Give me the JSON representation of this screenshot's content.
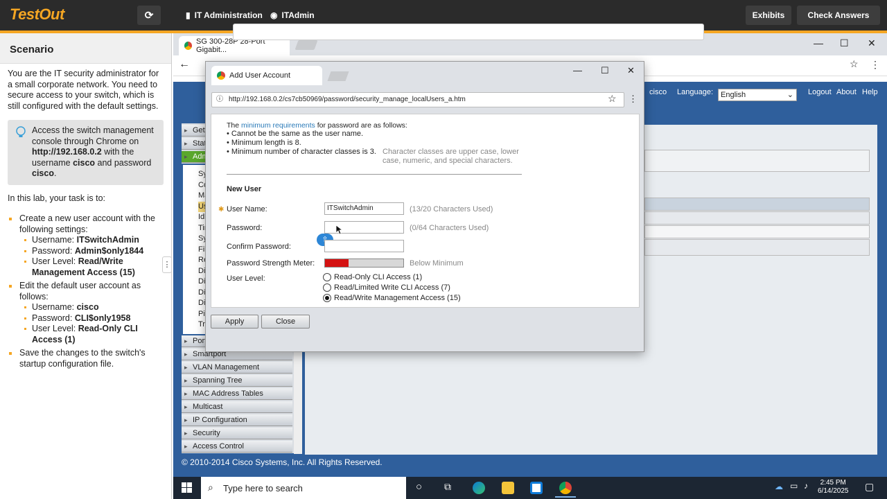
{
  "topbar": {
    "brand": "TestOut",
    "tab_admin": "IT Administration",
    "tab_itadmin": "ITAdmin",
    "exhibits": "Exhibits",
    "check_answers": "Check Answers"
  },
  "scenario": {
    "heading": "Scenario",
    "intro": "You are the IT security administrator for a small corporate network. You need to secure access to your switch, which is still configured with the default settings.",
    "callout_pre": "Access the switch management console through Chrome on ",
    "callout_url": "http://192.168.0.2",
    "callout_mid": " with the username ",
    "callout_user": "cisco",
    "callout_and": " and password ",
    "callout_pass": "cisco",
    "callout_end": ".",
    "task_intro": "In this lab, your task is to:",
    "task1": "Create a new user account with the following settings:",
    "t1_user_lbl": "Username: ",
    "t1_user": "ITSwitchAdmin",
    "t1_pass_lbl": "Password: ",
    "t1_pass": "Admin$only1844",
    "t1_level_lbl": "User Level: ",
    "t1_level": "Read/Write Management Access (15)",
    "task2": "Edit the default user account as follows:",
    "t2_user_lbl": "Username: ",
    "t2_user": "cisco",
    "t2_pass_lbl": "Password: ",
    "t2_pass": "CLI$only1958",
    "t2_level_lbl": "User Level: ",
    "t2_level": "Read-Only CLI Access (1)",
    "task3": "Save the changes to the switch's startup configuration file."
  },
  "browser": {
    "tab_title": "SG 300-28P 28-Port Gigabit...",
    "user": "cisco",
    "language_label": "Language:",
    "language_value": "English",
    "logout": "Logout",
    "about": "About",
    "help": "Help",
    "footer": "© 2010-2014 Cisco Systems, Inc. All Rights Reserved."
  },
  "nav": {
    "partial": [
      "Gett",
      "Statu",
      "Adm",
      "Sy",
      "Co",
      "Ma",
      "Us",
      "Idl",
      "Tin",
      "Sy",
      "File",
      "Re",
      "Dia",
      "Dis",
      "Dis",
      "Dis",
      "Pin",
      "Tra",
      "Port"
    ],
    "items": [
      "Smartport",
      "VLAN Management",
      "Spanning Tree",
      "MAC Address Tables",
      "Multicast",
      "IP Configuration",
      "Security",
      "Access Control"
    ]
  },
  "modal": {
    "tab_title": "Add User Account",
    "url": "http://192.168.0.2/cs7cb50969/password/security_manage_localUsers_a.htm",
    "req_pre": "The ",
    "req_link": "minimum requirements",
    "req_post": " for password are as follows:",
    "req1": "• Cannot be the same as the user name.",
    "req2": "• Minimum length is 8.",
    "req3": "• Minimum number of character classes is 3.",
    "req_note": "Character classes are upper case, lower case, numeric, and special characters.",
    "section": "New User",
    "username_label": "User Name:",
    "username_value": "ITSwitchAdmin",
    "username_note": "(13/20 Characters Used)",
    "password_label": "Password:",
    "password_note": "(0/64 Characters Used)",
    "confirm_label": "Confirm Password:",
    "strength_label": "Password Strength Meter:",
    "strength_value": "Below Minimum",
    "strength_fill": 0.3,
    "level_label": "User Level:",
    "level_opt1": "Read-Only CLI Access (1)",
    "level_opt2": "Read/Limited Write CLI Access (7)",
    "level_opt3": "Read/Write Management Access (15)",
    "apply": "Apply",
    "close": "Close"
  },
  "taskbar": {
    "search": "Type here to search",
    "time": "2:45 PM",
    "date": "6/14/2025"
  }
}
